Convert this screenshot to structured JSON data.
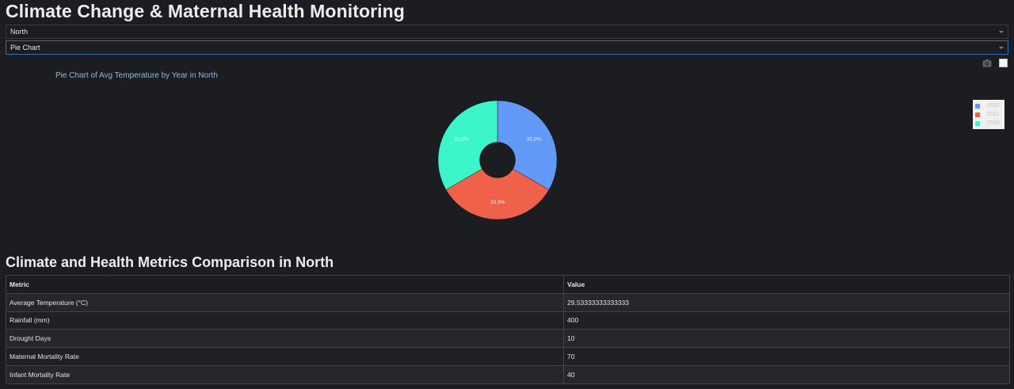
{
  "page": {
    "title": "Climate Change & Maternal Health Monitoring"
  },
  "filters": {
    "region": "North",
    "chart_type": "Pie Chart"
  },
  "modebar": {
    "icons": [
      "camera-icon",
      "checkbox-icon"
    ]
  },
  "colors": {
    "background": "#1c1d21",
    "slice_2022": "#6399f8",
    "slice_2021": "#ef614b",
    "slice_2020": "#3cf5c8",
    "title_text": "#8fb7de"
  },
  "chart_data": {
    "type": "pie",
    "title": "Pie Chart of Avg Temperature by Year in North",
    "hole": 0.3,
    "categories": [
      "2022",
      "2021",
      "2020"
    ],
    "values": [
      33.3,
      33.3,
      33.3
    ],
    "labels": [
      "33.3%",
      "33.3%",
      "33.3%"
    ],
    "legend": [
      "2022",
      "2021",
      "2020"
    ],
    "legend_position": "top-right"
  },
  "table_section": {
    "title": "Climate and Health Metrics Comparison in North",
    "headers": [
      "Metric",
      "Value"
    ],
    "rows": [
      [
        "Average Temperature (°C)",
        "29.53333333333333"
      ],
      [
        "Rainfall (mm)",
        "400"
      ],
      [
        "Drought Days",
        "10"
      ],
      [
        "Maternal Mortality Rate",
        "70"
      ],
      [
        "Infant Mortality Rate",
        "40"
      ]
    ]
  }
}
